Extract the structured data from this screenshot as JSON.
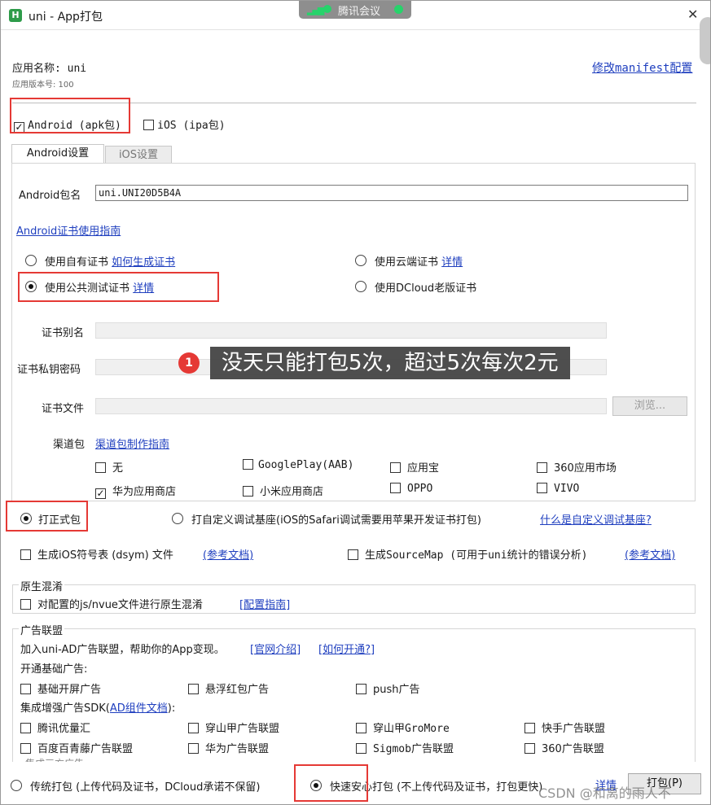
{
  "window": {
    "title": "uni - App打包",
    "app_icon": "H"
  },
  "overlay": {
    "meeting_label": "腾讯会议"
  },
  "app": {
    "name_label": "应用名称: uni",
    "version_label": "应用版本号: 100",
    "manifest_link": "修改manifest配置"
  },
  "platforms": [
    {
      "label": "Android (apk包)",
      "checked": true
    },
    {
      "label": "iOS (ipa包)",
      "checked": false
    }
  ],
  "tabs": [
    {
      "label": "Android设置",
      "active": true
    },
    {
      "label": "iOS设置",
      "active": false
    }
  ],
  "android": {
    "package_label": "Android包名",
    "package_value": "uni.UNI20D5B4A",
    "cert_guide_link": "Android证书使用指南",
    "cert_options": [
      {
        "label": "使用自有证书",
        "link": "如何生成证书",
        "selected": false
      },
      {
        "label": "使用云端证书",
        "link": "详情",
        "selected": false
      },
      {
        "label": "使用公共测试证书",
        "link": "详情",
        "selected": true
      },
      {
        "label": "使用DCloud老版证书",
        "link": "",
        "selected": false
      }
    ],
    "alias_label": "证书别名",
    "password_label": "证书私钥密码",
    "file_label": "证书文件",
    "browse_button": "浏览...",
    "channel_label": "渠道包",
    "channel_link": "渠道包制作指南",
    "channels": [
      {
        "label": "无",
        "checked": false
      },
      {
        "label": "GooglePlay(AAB)",
        "checked": false
      },
      {
        "label": "应用宝",
        "checked": false
      },
      {
        "label": "360应用市场",
        "checked": false
      },
      {
        "label": "华为应用商店",
        "checked": true
      },
      {
        "label": "小米应用商店",
        "checked": false
      },
      {
        "label": "OPPO",
        "checked": false
      },
      {
        "label": "VIVO",
        "checked": false
      }
    ]
  },
  "tooltip": {
    "badge": "1",
    "text": "没天只能打包5次，超过5次每次2元"
  },
  "build_type": {
    "formal_label": "打正式包",
    "custom_label": "打自定义调试基座(iOS的Safari调试需要用苹果开发证书打包)",
    "custom_link": "什么是自定义调试基座?"
  },
  "extras": {
    "dsym_label": "生成iOS符号表 (dsym) 文件",
    "dsym_link": "(参考文档)",
    "sourcemap_label": "生成SourceMap (可用于uni统计的错误分析)",
    "sourcemap_link": "(参考文档)"
  },
  "obfuscation": {
    "title": "原生混淆",
    "checkbox_label": "对配置的js/nvue文件进行原生混淆",
    "guide_link": "[配置指南]"
  },
  "ads": {
    "title": "广告联盟",
    "intro": "加入uni-AD广告联盟，帮助你的App变现。",
    "intro_link_1": "[官网介绍]",
    "intro_link_2": "[如何开通?]",
    "basic_title": "开通基础广告:",
    "basic_items": [
      "基础开屏广告",
      "悬浮红包广告",
      "push广告"
    ],
    "sdk_title_prefix": "集成增强广告SDK(",
    "sdk_title_link": "AD组件文档",
    "sdk_title_suffix": "):",
    "sdk_items": [
      "腾讯优量汇",
      "穿山甲广告联盟",
      "穿山甲GroMore",
      "快手广告联盟",
      "百度百青藤广告联盟",
      "华为广告联盟",
      "Sigmob广告联盟",
      "360广告联盟"
    ],
    "cut_row_text": "集成三方广告..."
  },
  "footer": {
    "traditional_label": "传统打包 (上传代码及证书，DCloud承诺不保留)",
    "fast_label": "快速安心打包 (不上传代码及证书，打包更快)",
    "detail_link": "详情",
    "pack_button": "打包(P)"
  },
  "watermark": "CSDN @和离的雨人不"
}
